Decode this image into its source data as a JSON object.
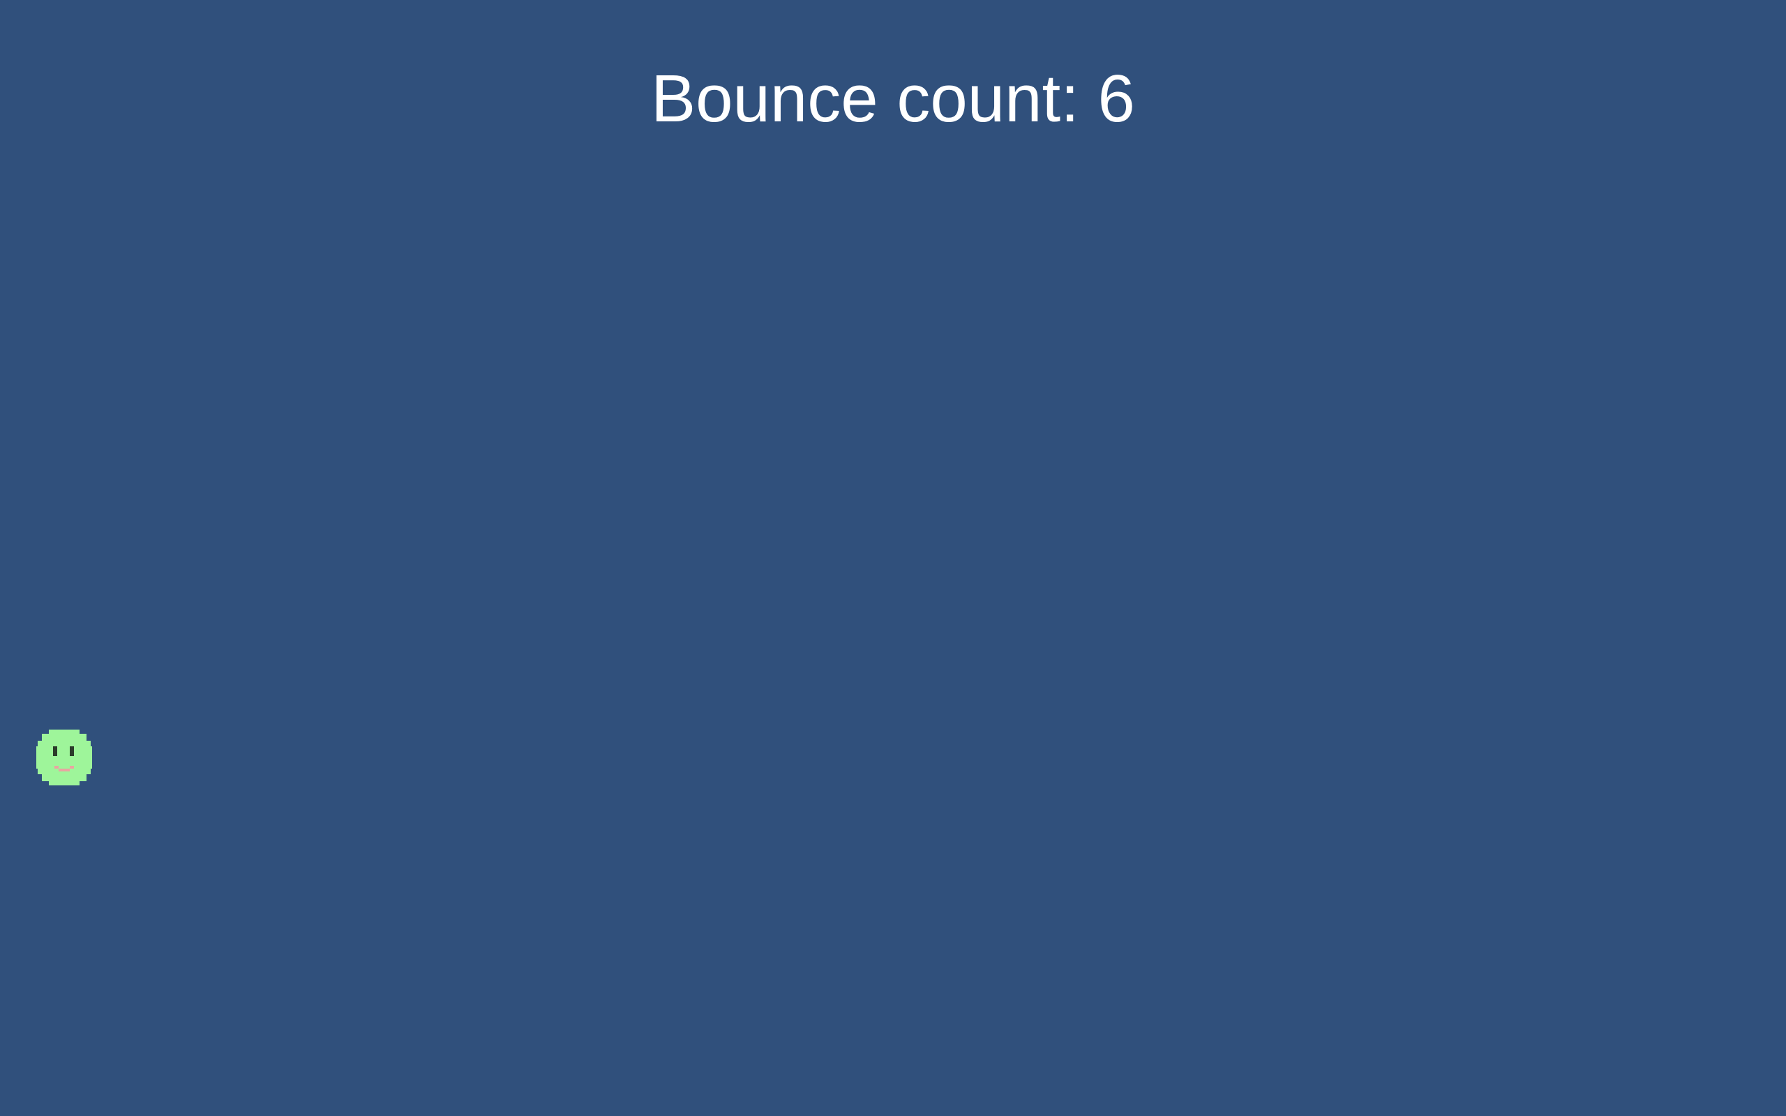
{
  "hud": {
    "bounce_label": "Bounce count:",
    "bounce_count": 6
  },
  "ball": {
    "icon": "smiley-face-icon",
    "fill_color": "#9ef59a",
    "eye_color": "#2b3b2a",
    "mouth_color": "#e8a6a1"
  },
  "colors": {
    "background": "#30507c",
    "text": "#ffffff"
  }
}
